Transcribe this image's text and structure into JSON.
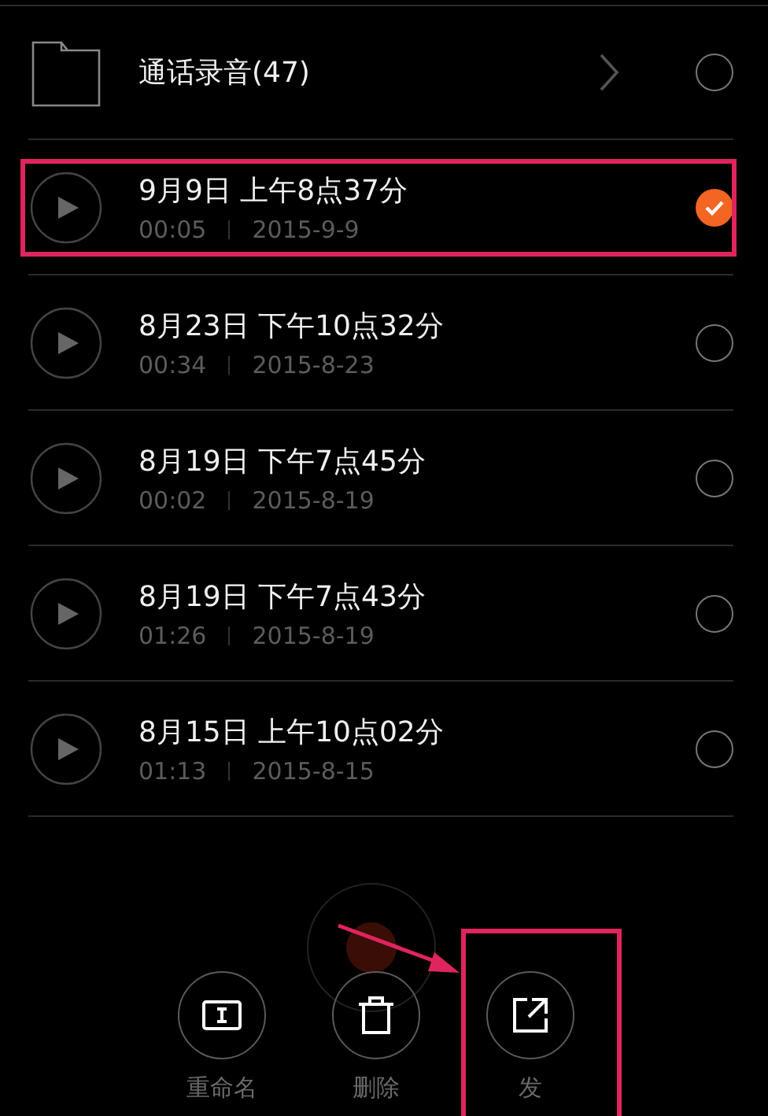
{
  "folder": {
    "name": "通话录音(47)",
    "selected": false
  },
  "recordings": [
    {
      "title": "9月9日 上午8点37分",
      "duration": "00:05",
      "date": "2015-9-9",
      "selected": true,
      "highlighted": true
    },
    {
      "title": "8月23日 下午10点32分",
      "duration": "00:34",
      "date": "2015-8-23",
      "selected": false,
      "highlighted": false
    },
    {
      "title": "8月19日 下午7点45分",
      "duration": "00:02",
      "date": "2015-8-19",
      "selected": false,
      "highlighted": false
    },
    {
      "title": "8月19日 下午7点43分",
      "duration": "01:26",
      "date": "2015-8-19",
      "selected": false,
      "highlighted": false
    },
    {
      "title": "8月15日 上午10点02分",
      "duration": "01:13",
      "date": "2015-8-15",
      "selected": false,
      "highlighted": false
    }
  ],
  "actions": [
    {
      "kind": "rename",
      "label": "重命名",
      "highlighted": false
    },
    {
      "kind": "delete",
      "label": "删除",
      "highlighted": false
    },
    {
      "kind": "share",
      "label": "发",
      "highlighted": true
    }
  ]
}
